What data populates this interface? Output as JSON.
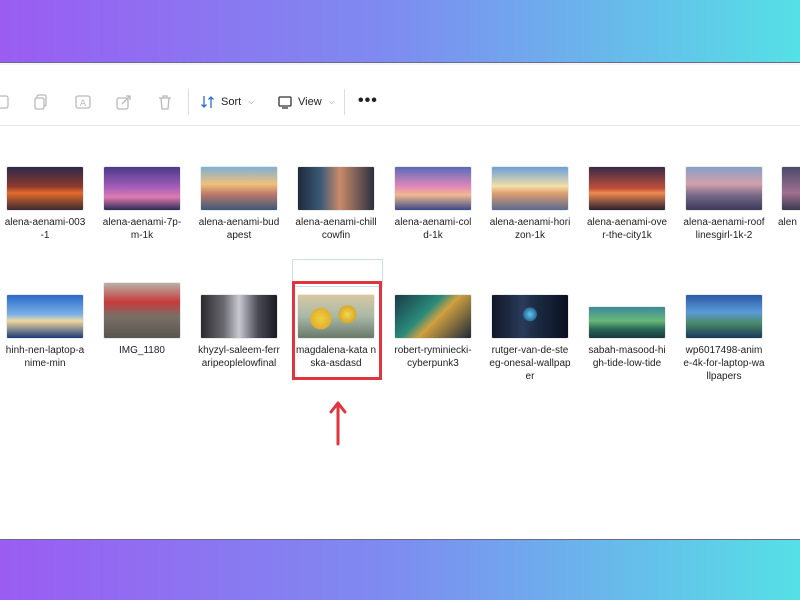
{
  "toolbar": {
    "sort_label": "Sort",
    "view_label": "View",
    "more_label": "•••"
  },
  "colors": {
    "highlight": "#e0353d",
    "accent_gradient_start": "#9a5cf2",
    "accent_gradient_end": "#55e0e6"
  },
  "files": {
    "row1": [
      {
        "label": "alena-aenami-003-1",
        "icon": "image-thumbnail-sunset-city"
      },
      {
        "label": "alena-aenami-7p-m-1k",
        "icon": "image-thumbnail-purple-dusk"
      },
      {
        "label": "alena-aenami-budapest",
        "icon": "image-thumbnail-clouds-water"
      },
      {
        "label": "alena-aenami-chillcowfin",
        "icon": "image-thumbnail-window-room"
      },
      {
        "label": "alena-aenami-cold-1k",
        "icon": "image-thumbnail-pink-clouds"
      },
      {
        "label": "alena-aenami-horizon-1k",
        "icon": "image-thumbnail-road-sky"
      },
      {
        "label": "alena-aenami-over-the-city1k",
        "icon": "image-thumbnail-city-dusk"
      },
      {
        "label": "alena-aenami-rooflinesgirl-1k-2",
        "icon": "image-thumbnail-rooftops"
      },
      {
        "label": "alen",
        "icon": "image-thumbnail-partial"
      }
    ],
    "row2": [
      {
        "label": "hinh-nen-laptop-anime-min",
        "icon": "image-thumbnail-anime-sky"
      },
      {
        "label": "IMG_1180",
        "icon": "image-thumbnail-street-photo"
      },
      {
        "label": "khyzyl-saleem-ferraripeoplelowfinal",
        "icon": "image-thumbnail-car-night"
      },
      {
        "label": "magdalena-kata nska-asdasd",
        "icon": "image-thumbnail-yellow-creatures"
      },
      {
        "label": "robert-ryminiecki-cyberpunk3",
        "icon": "image-thumbnail-cyberpunk-street"
      },
      {
        "label": "rutger-van-de-steeg-onesal-wallpaper",
        "icon": "image-thumbnail-neon-alley"
      },
      {
        "label": "sabah-masood-high-tide-low-tide",
        "icon": "image-thumbnail-green-village"
      },
      {
        "label": "wp6017498-anime-4k-for-laptop-wallpapers",
        "icon": "image-thumbnail-anime-house"
      }
    ]
  }
}
